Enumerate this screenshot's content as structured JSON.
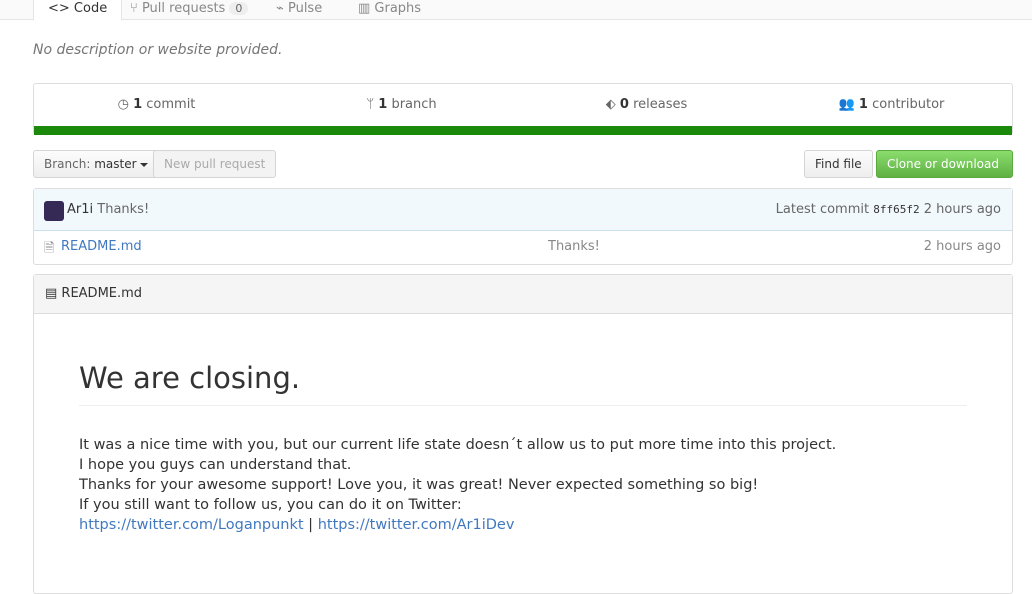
{
  "tabs": [
    {
      "label": "Code"
    },
    {
      "label": "Pull requests",
      "count": "0"
    },
    {
      "label": "Pulse"
    },
    {
      "label": "Graphs"
    }
  ],
  "description": "No description or website provided.",
  "summary": {
    "commits": {
      "n": "1",
      "label": "commit"
    },
    "branches": {
      "n": "1",
      "label": "branch"
    },
    "releases": {
      "n": "0",
      "label": "releases"
    },
    "contributors": {
      "n": "1",
      "label": "contributor"
    }
  },
  "toolbar": {
    "branch_prefix": "Branch:",
    "branch": "master",
    "new_pr": "New pull request",
    "find_file": "Find file",
    "clone": "Clone or download"
  },
  "commit": {
    "author": "Ar1i",
    "message": "Thanks!",
    "latest_label": "Latest commit",
    "sha": "8ff65f2",
    "time": "2 hours ago"
  },
  "files": [
    {
      "name": "README.md",
      "message": "Thanks!",
      "time": "2 hours ago"
    }
  ],
  "readme": {
    "title": "README.md",
    "heading": "We are closing.",
    "lines": [
      "It was a nice time with you, but our current life state doesn´t allow us to put more time into this project.",
      "I hope you guys can understand that.",
      "Thanks for your awesome support! Love you, it was great! Never expected something so big!",
      "If you still want to follow us, you can do it on Twitter:"
    ],
    "link1": "https://twitter.com/Loganpunkt",
    "sep": " | ",
    "link2": "https://twitter.com/Ar1iDev"
  }
}
